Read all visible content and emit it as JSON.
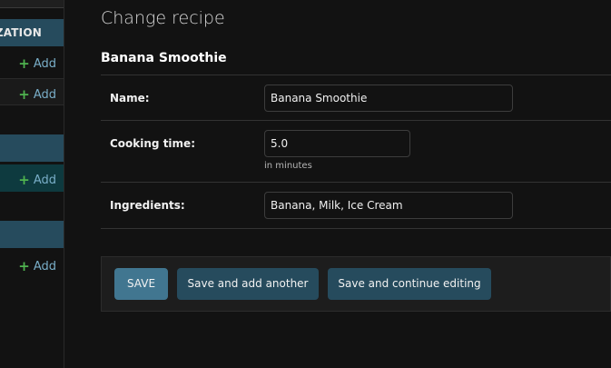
{
  "sidebar": {
    "header_1": "IZATION",
    "add_label": "Add",
    "header_2": "",
    "header_3": ""
  },
  "page": {
    "title": "Change recipe",
    "object_name": "Banana Smoothie"
  },
  "form": {
    "name": {
      "label": "Name:",
      "value": "Banana Smoothie"
    },
    "cooking_time": {
      "label": "Cooking time:",
      "value": "5.0",
      "help": "in minutes"
    },
    "ingredients": {
      "label": "Ingredients:",
      "value": "Banana, Milk, Ice Cream"
    }
  },
  "buttons": {
    "save": "SAVE",
    "save_add_another": "Save and add another",
    "save_continue": "Save and continue editing"
  },
  "colors": {
    "header_bg": "#264b5d",
    "primary_button": "#417690",
    "secondary_button": "#264b5d",
    "link": "#79aec8",
    "add_plus": "#4fb34f"
  }
}
